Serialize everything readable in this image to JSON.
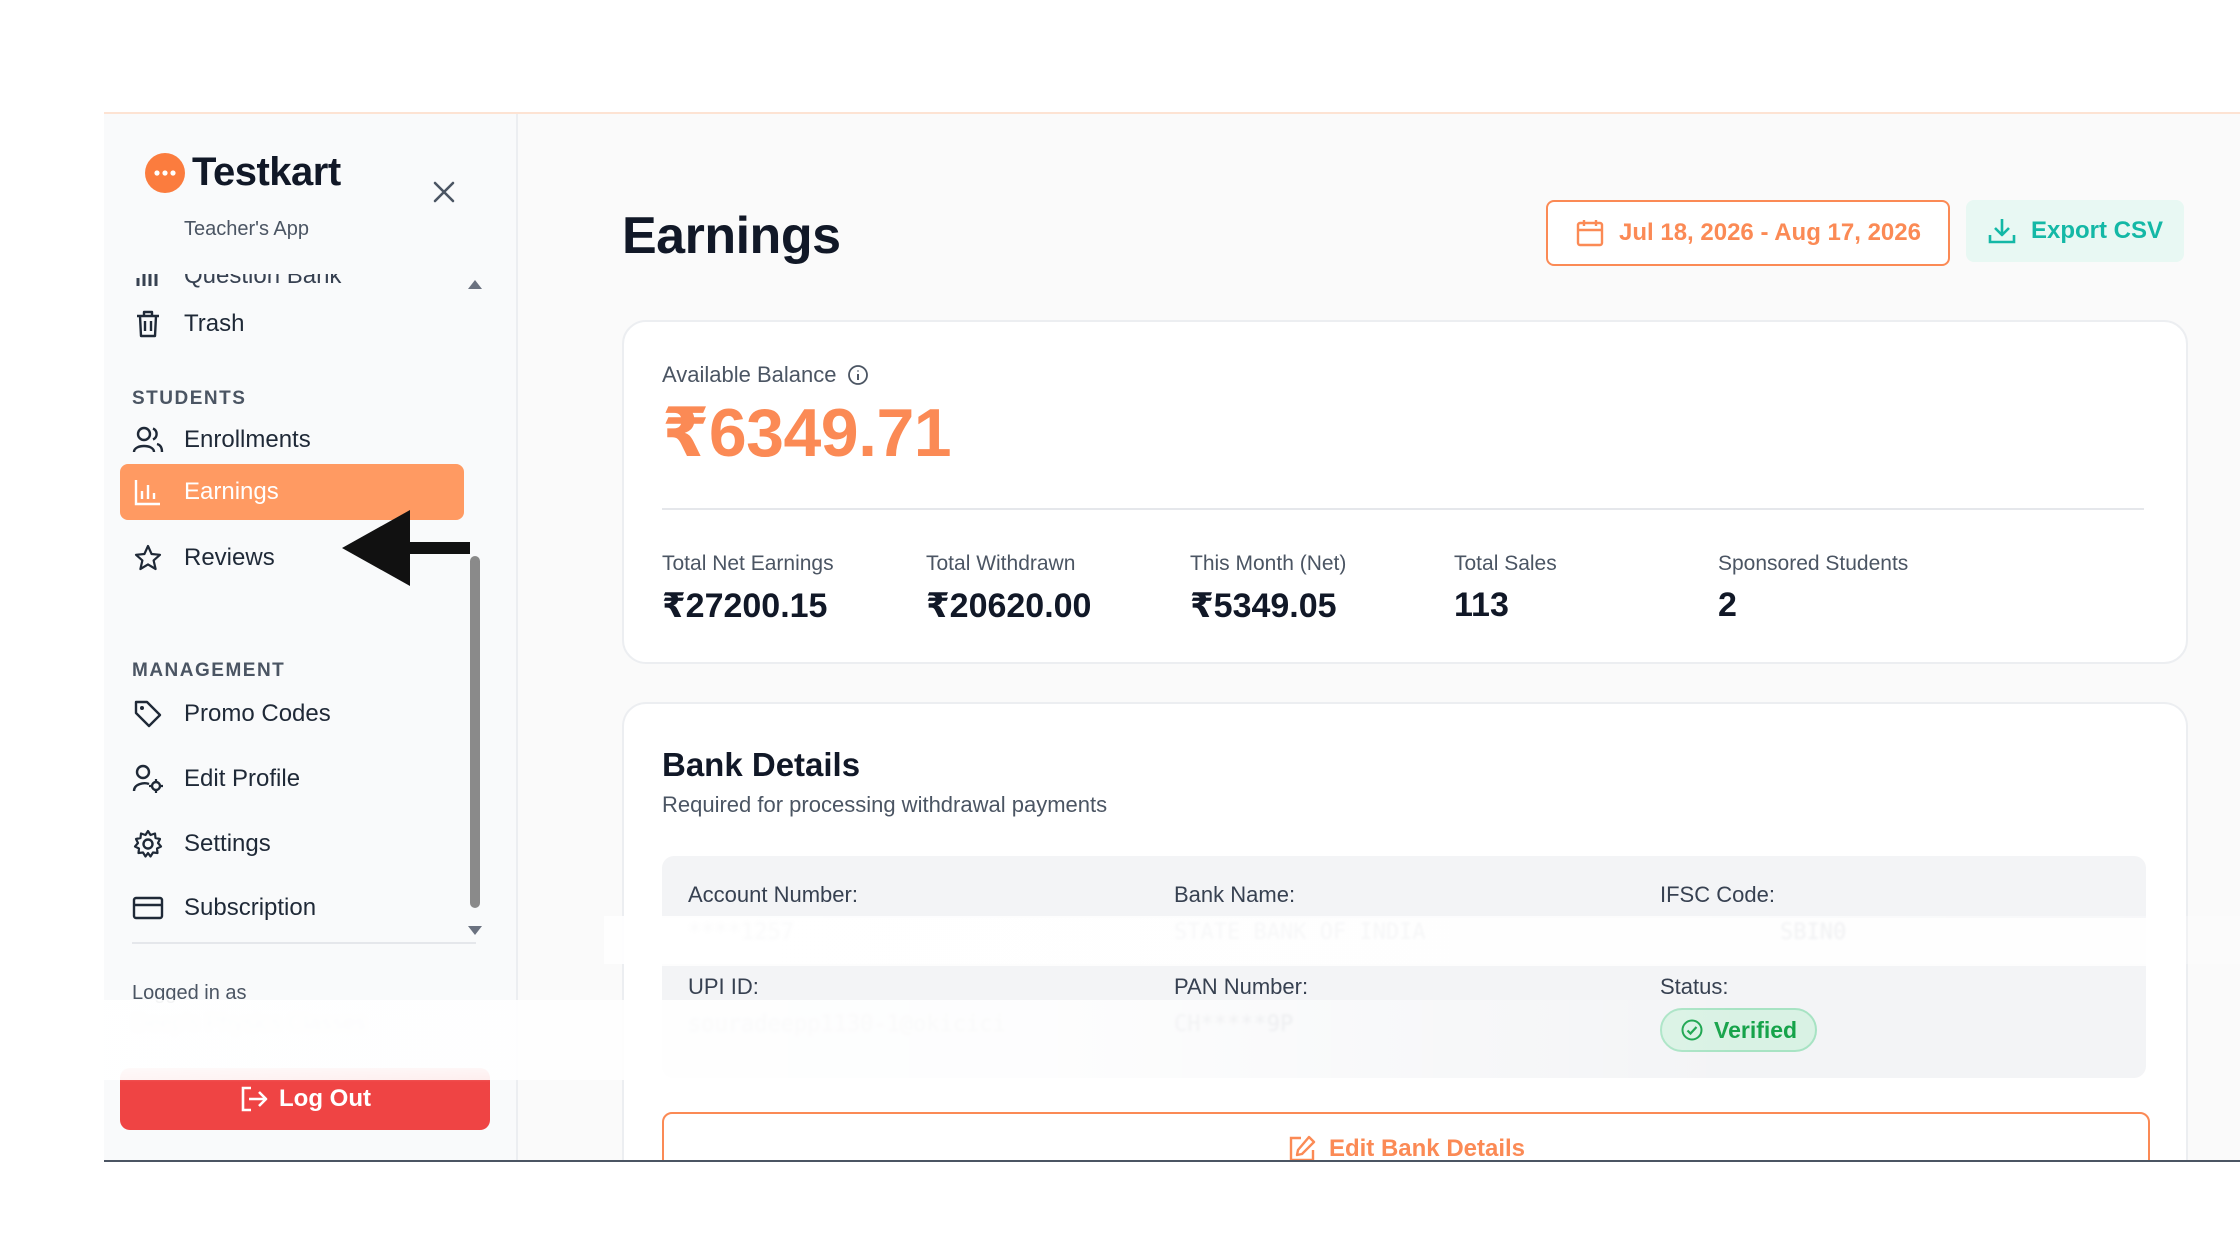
{
  "brand": {
    "name": "Testkart",
    "subtitle": "Teacher's App",
    "logo_color": "#fb7c3e"
  },
  "sidebar": {
    "partial_item": "Question Bank",
    "trash": "Trash",
    "sections": {
      "students": "STUDENTS",
      "management": "MANAGEMENT"
    },
    "items": {
      "enrollments": "Enrollments",
      "earnings": "Earnings",
      "reviews": "Reviews",
      "promo_codes": "Promo Codes",
      "edit_profile": "Edit Profile",
      "settings": "Settings",
      "subscription": "Subscription"
    },
    "logged_in_label": "Logged in as",
    "logged_in_name": "Deep's Physics Classes",
    "logout": "Log Out",
    "active_color": "#ff9a62"
  },
  "header": {
    "title": "Earnings",
    "date_range": "Jul 18, 2026 - Aug 17, 2026",
    "export": "Export CSV"
  },
  "balance": {
    "label": "Available Balance",
    "amount": "₹6349.71",
    "stats": [
      {
        "label": "Total Net Earnings",
        "value": "₹27200.15"
      },
      {
        "label": "Total Withdrawn",
        "value": "₹20620.00"
      },
      {
        "label": "This Month (Net)",
        "value": "₹5349.05"
      },
      {
        "label": "Total Sales",
        "value": "113"
      },
      {
        "label": "Sponsored Students",
        "value": "2"
      }
    ]
  },
  "bank": {
    "title": "Bank Details",
    "subtitle": "Required for processing withdrawal payments",
    "account_number_label": "Account Number:",
    "account_number": "****1257",
    "bank_name_label": "Bank Name:",
    "bank_name": "STATE BANK OF INDIA",
    "ifsc_label": "IFSC Code:",
    "ifsc": "SBIN0",
    "upi_label": "UPI ID:",
    "upi": "souradeepp1130-1@okicici",
    "pan_label": "PAN Number:",
    "pan": "CH*****9P",
    "status_label": "Status:",
    "status": "Verified",
    "edit": "Edit Bank Details"
  },
  "colors": {
    "accent": "#fb8a55",
    "teal": "#14b8a6",
    "danger": "#ef4444",
    "success": "#16a34a"
  }
}
